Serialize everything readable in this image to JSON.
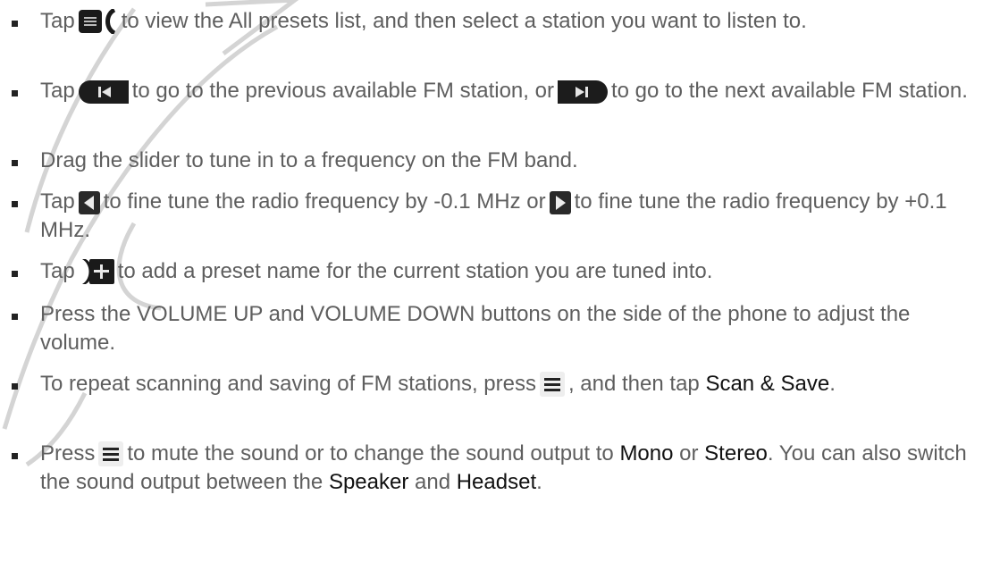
{
  "doc": {
    "items": [
      {
        "parts": [
          "Tap",
          "to view the All presets list, and then select a station you want to listen to."
        ],
        "icons": [
          "presets-list-icon"
        ]
      },
      {
        "parts": [
          "Tap",
          "to go to the previous available FM station, or",
          "to go to the next available FM station."
        ],
        "icons": [
          "previous-station-icon",
          "next-station-icon"
        ]
      },
      {
        "parts": [
          "Drag the slider to tune in to a frequency on the FM band."
        ],
        "icons": []
      },
      {
        "parts": [
          "Tap",
          "to fine tune the radio frequency by -0.1 MHz or",
          "to fine tune the radio frequency by +0.1 MHz."
        ],
        "icons": [
          "fine-tune-down-icon",
          "fine-tune-up-icon"
        ]
      },
      {
        "parts": [
          "Tap",
          "to add a preset name for the current station you are tuned into."
        ],
        "icons": [
          "add-preset-icon"
        ]
      },
      {
        "parts": [
          "Press the VOLUME UP and VOLUME DOWN buttons on the side of the phone to adjust the volume."
        ],
        "icons": []
      },
      {
        "parts": [
          "To repeat scanning and saving of FM stations, press",
          ", and then tap",
          "Scan & Save",
          "."
        ],
        "icons": [
          "menu-icon"
        ]
      },
      {
        "parts": [
          "Press",
          "to mute the sound or to change the sound output to",
          "Mono",
          "or",
          "Stereo",
          ". You can also switch the sound output between the",
          "Speaker",
          "and",
          "Headset",
          "."
        ],
        "icons": [
          "menu-icon"
        ]
      }
    ]
  },
  "colors": {
    "text": "#5e5e5e",
    "keyword": "#111111",
    "bullet": "#222222",
    "watermark": "#cfcfcf"
  }
}
